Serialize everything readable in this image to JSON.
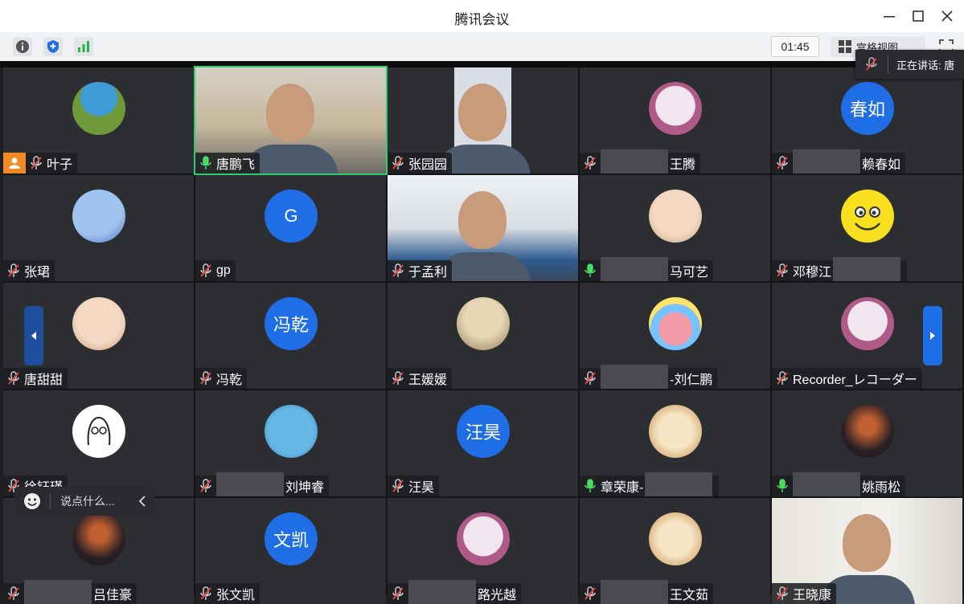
{
  "window": {
    "title": "腾讯会议"
  },
  "toolbar": {
    "timer": "01:45",
    "view_label": "宫格视图"
  },
  "speaking": {
    "label": "正在讲话: 唐"
  },
  "chat": {
    "placeholder": "说点什么..."
  },
  "participants": [
    {
      "name": "叶子",
      "avatar": "nature-photo-avatar",
      "muted": true,
      "host": true
    },
    {
      "name": "唐鹏飞",
      "avatar": "video",
      "muted": false
    },
    {
      "name": "张园园",
      "avatar": "video",
      "muted": true
    },
    {
      "name": "王腾",
      "avatar": "anime-avatar",
      "muted": true,
      "redacted_prefix": true
    },
    {
      "name": "赖春如",
      "avatar_text": "春如",
      "muted": true,
      "redacted_prefix": true
    },
    {
      "name": "张珺",
      "avatar": "sky-photo-avatar",
      "muted": true
    },
    {
      "name": "gp",
      "avatar_text": "G",
      "muted": true
    },
    {
      "name": "于孟利",
      "avatar": "video",
      "muted": true
    },
    {
      "name": "马可艺",
      "avatar": "cat-avatar",
      "muted": false,
      "redacted_prefix": true
    },
    {
      "name": "邓穆江",
      "avatar": "smiley-avatar",
      "muted": true,
      "redacted_suffix": true
    },
    {
      "name": "唐甜甜",
      "avatar": "cat-avatar",
      "muted": true
    },
    {
      "name": "冯乾",
      "avatar_text": "冯乾",
      "muted": true
    },
    {
      "name": "王媛媛",
      "avatar": "girl-photo-avatar",
      "muted": true
    },
    {
      "name": "-刘仁鹏",
      "avatar": "cartoon-avatar",
      "muted": true,
      "redacted_prefix": true
    },
    {
      "name": "Recorder_レコーダー",
      "avatar": "anime-avatar",
      "muted": true
    },
    {
      "name": "徐钰瑾",
      "avatar": "sketch-avatar",
      "muted": true
    },
    {
      "name": "刘坤睿",
      "avatar": "swimmer-avatar",
      "muted": true,
      "redacted_prefix": true
    },
    {
      "name": "汪昊",
      "avatar_text": "汪昊",
      "muted": true
    },
    {
      "name": "章荣康-",
      "avatar": "dog-avatar",
      "muted": false,
      "redacted_suffix": true
    },
    {
      "name": "姚雨松",
      "avatar": "sunset-avatar",
      "muted": false,
      "redacted_prefix": true
    },
    {
      "name": "吕佳豪",
      "avatar": "sunset-avatar",
      "muted": true,
      "redacted_prefix": true
    },
    {
      "name": "张文凯",
      "avatar_text": "文凯",
      "muted": true
    },
    {
      "name": "路光越",
      "avatar": "anime-avatar",
      "muted": true,
      "redacted_prefix": true
    },
    {
      "name": "王文茹",
      "avatar": "dog-avatar",
      "muted": true,
      "redacted_prefix": true
    },
    {
      "name": "王晓康",
      "avatar": "video",
      "muted": true
    }
  ]
}
